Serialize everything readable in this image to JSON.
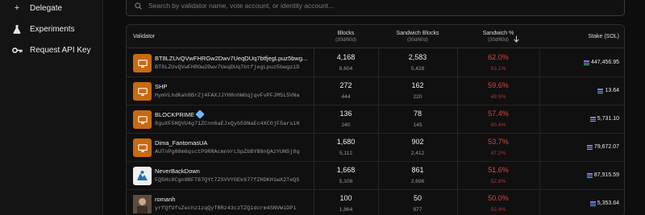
{
  "sidebar": {
    "items": [
      {
        "label": "Delegate",
        "icon": "plus-icon"
      },
      {
        "label": "Experiments",
        "icon": "flask-icon"
      },
      {
        "label": "Request API Key",
        "icon": "key-icon"
      }
    ]
  },
  "search": {
    "placeholder": "Search by validator name, vote account, or identity account..."
  },
  "table": {
    "headers": {
      "validator": "Validator",
      "blocks": "Blocks",
      "blocks_sub": "(30d/60d)",
      "sandwich_blocks": "Sandwich Blocks",
      "sandwich_blocks_sub": "(30d/60d)",
      "sandwich_pct": "Sandwich %",
      "sandwich_pct_sub": "(30d/60d)",
      "stake": "Stake (SOL)"
    },
    "rows": [
      {
        "name": "BT8LZUvQVwFHRGw2Dwv7UeqDUq7btfjegLpuz5bwg...",
        "address": "BT8LZUvQVwFHRGw2Dwv7UeqDUq7btfjegLpuz5bwgziD",
        "blocks": "4,168",
        "blocks_60d": "8,604",
        "sandwich": "2,583",
        "sandwich_60d": "5,428",
        "pct": "62.0%",
        "pct_60d": "63.1%",
        "stake": "447,456.95",
        "avatar": "monitor-icon"
      },
      {
        "name": "SHP",
        "address": "HymVLhdKah8BrZj4FAXJJYH8nhWGqjqvFvPFJM5L5VNa",
        "blocks": "272",
        "blocks_60d": "444",
        "sandwich": "162",
        "sandwich_60d": "220",
        "pct": "59.6%",
        "pct_60d": "49.5%",
        "stake": "13.64",
        "avatar": "monitor-icon"
      },
      {
        "name": "BLOCKPRIME",
        "address": "8guXF5HQVU4g71ZCnn6aEJxQyb59NaEc4XCGjF5arsiH",
        "blocks": "136",
        "blocks_60d": "240",
        "sandwich": "78",
        "sandwich_60d": "145",
        "pct": "57.4%",
        "pct_60d": "60.4%",
        "stake": "5,731.10",
        "avatar": "monitor-icon"
      },
      {
        "name": "Dima_FantomasUA",
        "address": "AUTnPg88m6qsctP9RRAcmnVrLSpZbBYB8nQAzYUN5j8q",
        "blocks": "1,680",
        "blocks_60d": "5,112",
        "sandwich": "902",
        "sandwich_60d": "2,412",
        "pct": "53.7%",
        "pct_60d": "47.2%",
        "stake": "79,672.07",
        "avatar": "monitor-icon"
      },
      {
        "name": "NeverBackDown",
        "address": "FQ5Hc8Cgn8BFT87QYt7ZSVVYGEk677fZHDKH1wX2TeQ5",
        "blocks": "1,668",
        "blocks_60d": "5,108",
        "sandwich": "861",
        "sandwich_60d": "2,696",
        "pct": "51.6%",
        "pct_60d": "52.8%",
        "stake": "87,915.59",
        "avatar": "logo-icon"
      },
      {
        "name": "romanh",
        "address": "yrfQfUfsZechz1zqQyTRRz43czTZQidcrm4SNVWiDPi",
        "blocks": "100",
        "blocks_60d": "1,864",
        "sandwich": "50",
        "sandwich_60d": "977",
        "pct": "50.0%",
        "pct_60d": "52.4%",
        "stake": "5,353.64",
        "avatar": "photo-avatar"
      }
    ]
  },
  "colors": {
    "accent_orange": "#c76a12",
    "danger_red": "#e04343"
  }
}
